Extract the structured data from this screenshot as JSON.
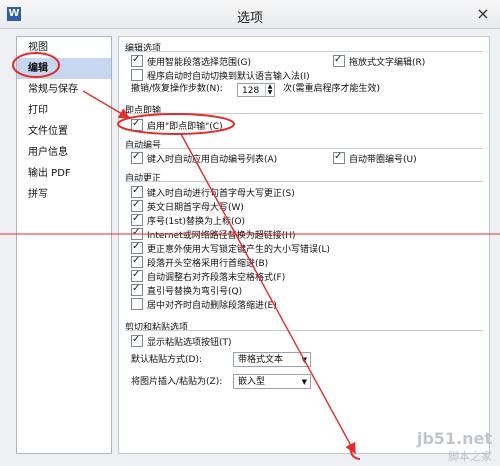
{
  "window": {
    "title": "选项",
    "app_icon": "W"
  },
  "sidebar": {
    "items": [
      {
        "label": "视图"
      },
      {
        "label": "编辑",
        "active": true
      },
      {
        "label": "常规与保存"
      },
      {
        "label": "打印"
      },
      {
        "label": "文件位置"
      },
      {
        "label": "用户信息"
      },
      {
        "label": "输出 PDF"
      },
      {
        "label": "拼写"
      }
    ]
  },
  "editing": {
    "title": "编辑选项",
    "smart_paragraph": "使用智能段落选择范围(G)",
    "drag_edit": "拖放式文字编辑(R)",
    "auto_switch_ime": "程序启动时自动切换到默认语言输入法(I)",
    "undo_label": "撤销/恢复操作步数(N):",
    "undo_value": "128",
    "undo_hint": "次(需重启程序才能生效)"
  },
  "instant_input": {
    "title": "即点即输",
    "enable": "启用\"即点即输\"(C)"
  },
  "auto_numbering": {
    "title": "自动编号",
    "apply_on_input": "键入时自动应用自动编号列表(A)",
    "auto_circle": "自动带圈编号(U)"
  },
  "autocorrect": {
    "title": "自动更正",
    "items": [
      {
        "label": "键入时自动进行句首字母大写更正(S)",
        "checked": true
      },
      {
        "label": "英文日期首字母大写(W)",
        "checked": true
      },
      {
        "label": "序号(1st)替换为上标(O)",
        "checked": true
      },
      {
        "label": "Internet或网络路径替换为超链接(H)",
        "checked": true
      },
      {
        "label": "更正意外使用大写锁定键产生的大小写错误(L)",
        "checked": true
      },
      {
        "label": "段落开头空格采用行首缩进(B)",
        "checked": true
      },
      {
        "label": "自动调整右对齐段落末空格格式(F)",
        "checked": true
      },
      {
        "label": "直引号替换为弯引号(Q)",
        "checked": true
      },
      {
        "label": "居中对齐时自动删除段落缩进(E)",
        "checked": false
      }
    ]
  },
  "paste": {
    "title": "剪切和粘贴选项",
    "show_button": "显示粘贴选项按钮(T)",
    "default_label": "默认粘贴方式(D):",
    "default_value": "带格式文本",
    "image_label": "将图片插入/粘贴为(Z):",
    "image_value": "嵌入型"
  },
  "watermark": {
    "line1": "jb51.net",
    "line2": "脚本之家"
  },
  "colors": {
    "annotation": "#e52b2b",
    "selected_sidebar": "#c6d7ef"
  }
}
